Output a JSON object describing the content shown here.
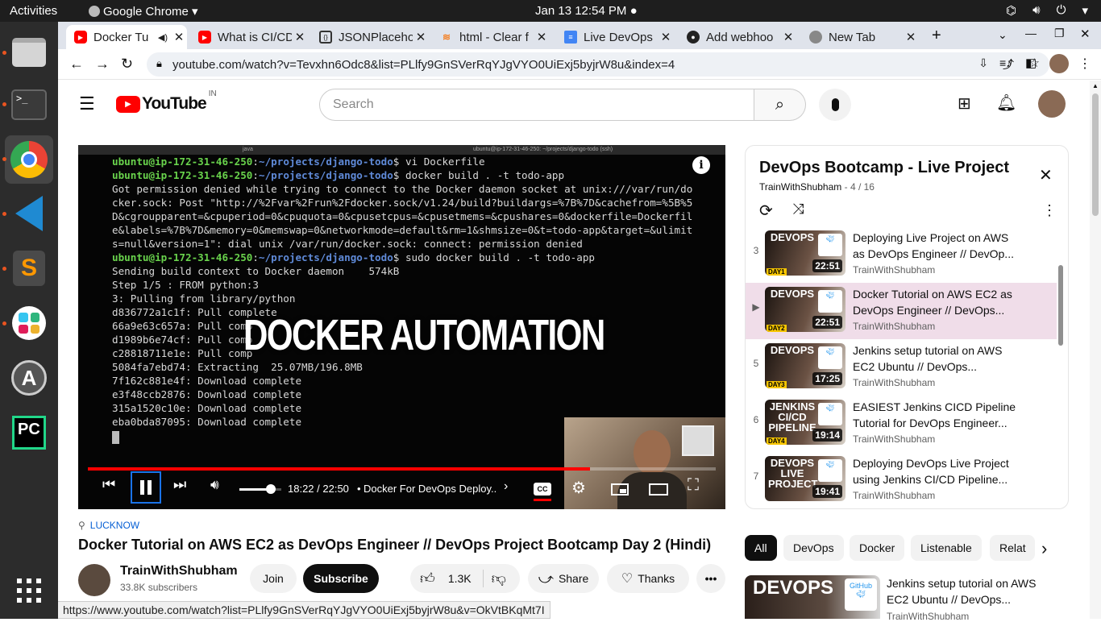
{
  "system": {
    "activities": "Activities",
    "app_name": "Google Chrome",
    "clock": "Jan 13  12:54 PM"
  },
  "tabs": [
    {
      "title": "Docker Tu",
      "active": true
    },
    {
      "title": "What is CI/CD",
      "active": false
    },
    {
      "title": "JSONPlaceholder",
      "active": false
    },
    {
      "title": "html - Clear f",
      "active": false
    },
    {
      "title": "Live DevOps",
      "active": false
    },
    {
      "title": "Add webhoo",
      "active": false
    },
    {
      "title": "New Tab",
      "active": false
    }
  ],
  "toolbar": {
    "url": "youtube.com/watch?v=Tevxhn6Odc8&list=PLlfy9GnSVerRqYJgVYO0UiExj5byjrW8u&index=4"
  },
  "youtube": {
    "logo_text": "YouTube",
    "region": "IN",
    "search_placeholder": "Search"
  },
  "terminal": {
    "header_left": "java",
    "header_right": "ubuntu@ip-172-31-46-250: ~/projects/django-todo (ssh)",
    "lines": [
      {
        "prompt": "ubuntu@ip-172-31-46-250",
        "path": "~/projects/django-todo",
        "cmd": "$ vi Dockerfile"
      },
      {
        "prompt": "ubuntu@ip-172-31-46-250",
        "path": "~/projects/django-todo",
        "cmd": "$ docker build . -t todo-app"
      },
      {
        "text": "Got permission denied while trying to connect to the Docker daemon socket at unix:///var/run/do"
      },
      {
        "text": "cker.sock: Post \"http://%2Fvar%2Frun%2Fdocker.sock/v1.24/build?buildargs=%7B%7D&cachefrom=%5B%5"
      },
      {
        "text": "D&cgroupparent=&cpuperiod=0&cpuquota=0&cpusetcpus=&cpusetmems=&cpushares=0&dockerfile=Dockerfil"
      },
      {
        "text": "e&labels=%7B%7D&memory=0&memswap=0&networkmode=default&rm=1&shmsize=0&t=todo-app&target=&ulimit"
      },
      {
        "text": "s=null&version=1\": dial unix /var/run/docker.sock: connect: permission denied"
      },
      {
        "prompt": "ubuntu@ip-172-31-46-250",
        "path": "~/projects/django-todo",
        "cmd": "$ sudo docker build . -t todo-app"
      },
      {
        "text": "Sending build context to Docker daemon    574kB"
      },
      {
        "text": "Step 1/5 : FROM python:3"
      },
      {
        "text": "3: Pulling from library/python"
      },
      {
        "text": "d836772a1c1f: Pull complete"
      },
      {
        "text": "66a9e63c657a: Pull comp"
      },
      {
        "text": "d1989b6e74cf: Pull comp"
      },
      {
        "text": "c28818711e1e: Pull comp"
      },
      {
        "text": "5084fa7ebd74: Extracting  25.07MB/196.8MB"
      },
      {
        "text": "7f162c881e4f: Download complete"
      },
      {
        "text": "e3f48ccb2876: Download complete"
      },
      {
        "text": "315a1520c10e: Download complete"
      },
      {
        "text": "eba0bda87095: Download complete"
      }
    ]
  },
  "player": {
    "overlay_title": "DOCKER AUTOMATION",
    "time": "18:22 / 22:50",
    "chapter": "Docker For DevOps Deploy...",
    "progress": 0.8,
    "volume": 0.75
  },
  "video": {
    "location": "LUCKNOW",
    "title": "Docker Tutorial on AWS EC2 as DevOps Engineer // DevOps Project Bootcamp Day 2 (Hindi)",
    "channel": "TrainWithShubham",
    "subscribers": "33.8K subscribers",
    "join_label": "Join",
    "subscribe_label": "Subscribe",
    "likes": "1.3K",
    "share_label": "Share",
    "thanks_label": "Thanks"
  },
  "playlist": {
    "title": "DevOps Bootcamp - Live Project",
    "channel": "TrainWithShubham",
    "position": "- 4 / 16",
    "items": [
      {
        "num": "3",
        "title": "Deploying Live Project on AWS as DevOps Engineer // DevOp...",
        "channel": "TrainWithShubham",
        "duration": "22:51",
        "day": "DAY1",
        "thumb_text": "DEVOPS"
      },
      {
        "num": "▶",
        "title": "Docker Tutorial on AWS EC2 as DevOps Engineer // DevOps...",
        "channel": "TrainWithShubham",
        "duration": "22:51",
        "day": "DAY2",
        "thumb_text": "DEVOPS",
        "current": true
      },
      {
        "num": "5",
        "title": "Jenkins setup tutorial on AWS EC2 Ubuntu // DevOps...",
        "channel": "TrainWithShubham",
        "duration": "17:25",
        "day": "DAY3",
        "thumb_text": "DEVOPS"
      },
      {
        "num": "6",
        "title": "EASIEST Jenkins CICD Pipeline Tutorial for DevOps Engineer...",
        "channel": "TrainWithShubham",
        "duration": "19:14",
        "day": "DAY4",
        "thumb_text": "JENKINS CI/CD PIPELINE"
      },
      {
        "num": "7",
        "title": "Deploying DevOps Live Project using Jenkins CI/CD Pipeline...",
        "channel": "TrainWithShubham",
        "duration": "19:41",
        "day": "",
        "thumb_text": "DEVOPS LIVE PROJECT"
      }
    ]
  },
  "chips": [
    "All",
    "DevOps",
    "Docker",
    "Listenable",
    "Relat"
  ],
  "recommended": {
    "title": "Jenkins setup tutorial on AWS EC2 Ubuntu // DevOps...",
    "channel": "TrainWithShubham",
    "thumb_text": "DEVOPS"
  },
  "status_url": "https://www.youtube.com/watch?list=PLlfy9GnSVerRqYJgVYO0UiExj5byjrW8u&v=OkVtBKqMt7I",
  "colors": {
    "yt_red": "#ff0000",
    "current_item_bg": "#f0dde9",
    "progress_red": "#f00"
  }
}
